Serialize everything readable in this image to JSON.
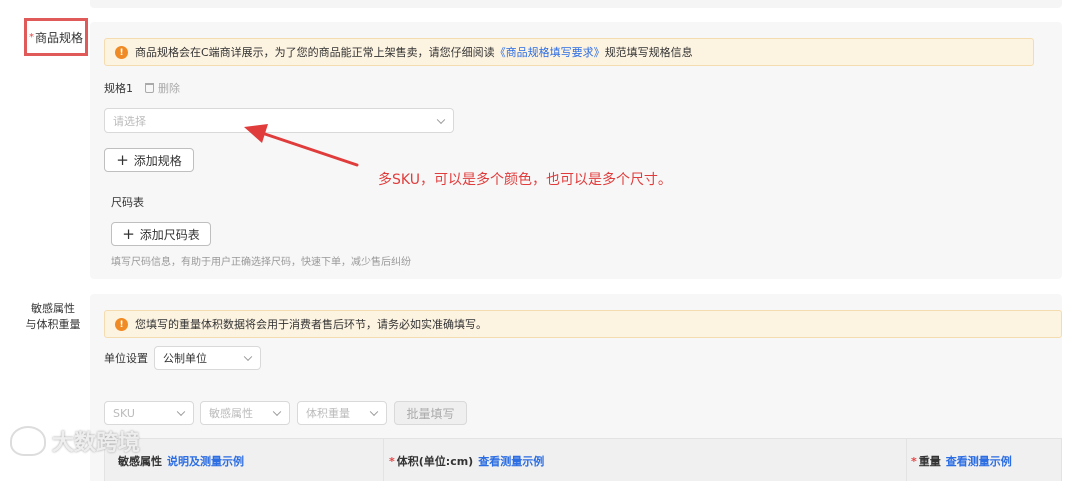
{
  "spec_section": {
    "required_mark": "*",
    "label": "商品规格",
    "notice_text": "商品规格会在C端商详展示，为了您的商品能正常上架售卖，请您仔细阅读",
    "notice_link": "《商品规格填写要求》",
    "notice_suffix": "规范填写规格信息",
    "spec_title": "规格1",
    "delete_label": "删除",
    "spec_select_placeholder": "请选择",
    "add_spec_label": "添加规格",
    "size_chart_title": "尺码表",
    "add_size_chart_label": "添加尺码表",
    "size_chart_helper": "填写尺码信息，有助于用户正确选择尺码，快速下单，减少售后纠纷"
  },
  "annotation": {
    "text": "多SKU，可以是多个颜色，也可以是多个尺寸。",
    "color": "#e03c3c"
  },
  "sensitive_section": {
    "label_line1": "敏感属性",
    "label_line2": "与体积重量",
    "notice_text": "您填写的重量体积数据将会用于消费者售后环节，请务必如实准确填写。",
    "unit_label": "单位设置",
    "unit_value": "公制单位",
    "filters": {
      "sku_placeholder": "SKU",
      "sensitive_placeholder": "敏感属性",
      "volume_placeholder": "体积重量",
      "batch_fill_label": "批量填写"
    },
    "table_headers": [
      {
        "required": "",
        "label": "敏感属性",
        "link": "说明及测量示例"
      },
      {
        "required": "*",
        "label": "体积(单位:cm)",
        "link": "查看测量示例"
      },
      {
        "required": "*",
        "label": "重量",
        "link": "查看测量示例"
      }
    ]
  },
  "watermark": {
    "text": "大数跨境"
  },
  "colors": {
    "accent_link": "#2b6de3",
    "warning_icon": "#f08a24",
    "highlight_box": "#e05a5a",
    "notice_bg": "#fdf3e1"
  }
}
